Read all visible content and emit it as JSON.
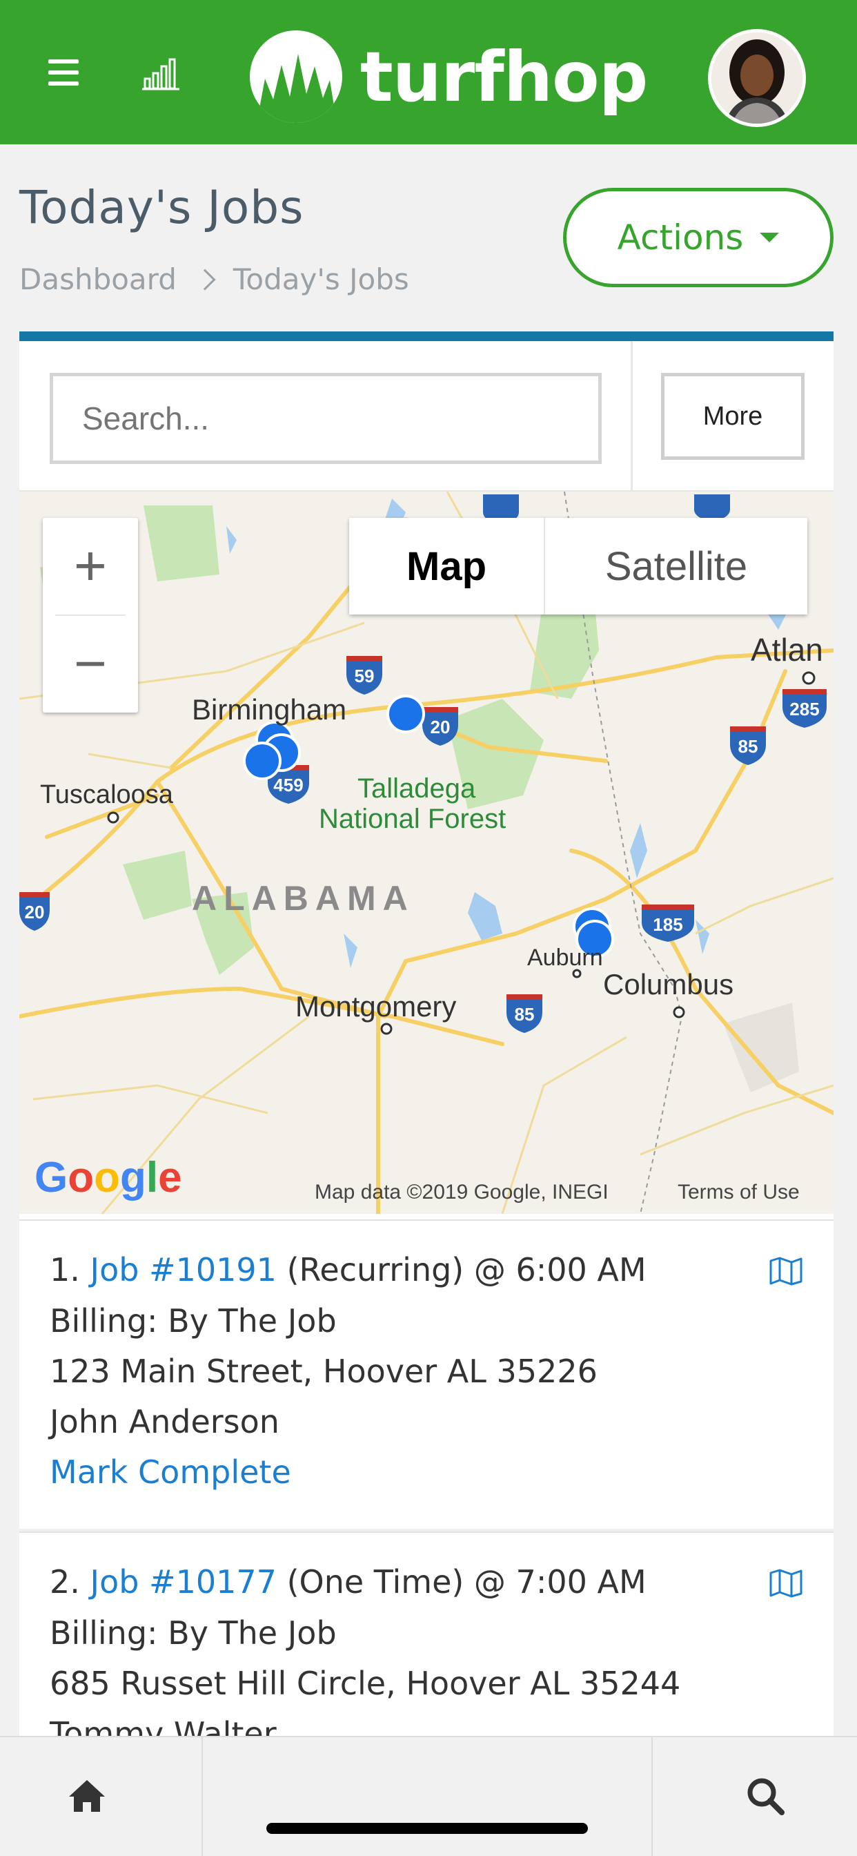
{
  "header": {
    "brand": "turfhop",
    "colors": {
      "bar": "#36a42d",
      "accent_blue": "#1478a6",
      "link": "#1a7fd1"
    },
    "icons": [
      "menu-icon",
      "chart-icon",
      "avatar"
    ]
  },
  "page": {
    "title": "Today's Jobs",
    "breadcrumb": [
      "Dashboard",
      "Today's Jobs"
    ],
    "actions_label": "Actions"
  },
  "toolbar": {
    "search_placeholder": "Search...",
    "more_label": "More"
  },
  "map": {
    "zoom_in": "+",
    "zoom_out": "−",
    "type_map": "Map",
    "type_satellite": "Satellite",
    "labels": {
      "birmingham": "Birmingham",
      "tuscaloosa": "Tuscaloosa",
      "talladega": "Talladega",
      "national_forest": "National Forest",
      "alabama": "ALABAMA",
      "montgomery": "Montgomery",
      "auburn": "Auburn",
      "columbus": "Columbus",
      "atlanta": "Atlan"
    },
    "shields": {
      "i59": "59",
      "i20": "20",
      "i459": "459",
      "i85": "85",
      "i285": "285",
      "i185": "185"
    },
    "google": "Google",
    "attribution": "Map data ©2019 Google, INEGI",
    "terms": "Terms of Use"
  },
  "jobs": [
    {
      "number": "1.",
      "link": "Job #10191",
      "detail": "(Recurring) @ 6:00 AM",
      "billing": "Billing: By The Job",
      "address": "123 Main Street, Hoover AL 35226",
      "customer": "John Anderson",
      "action": "Mark Complete"
    },
    {
      "number": "2.",
      "link": "Job #10177",
      "detail": "(One Time) @ 7:00 AM",
      "billing": "Billing: By The Job",
      "address": "685 Russet Hill Circle, Hoover AL 35244",
      "customer": "Tommy Walter"
    }
  ]
}
